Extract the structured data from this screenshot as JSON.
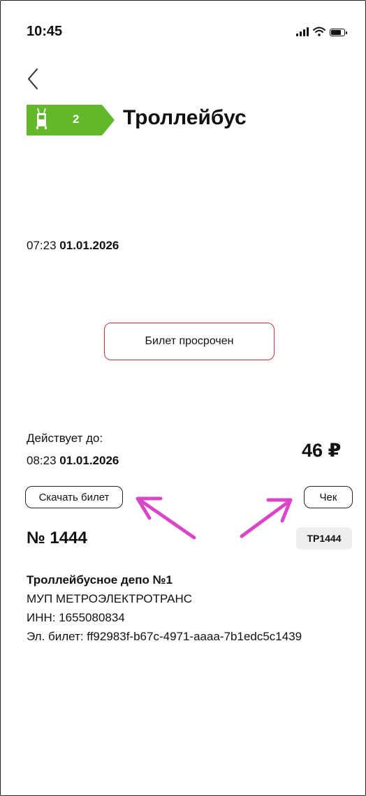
{
  "status_bar": {
    "time": "10:45"
  },
  "header": {
    "route_number": "2",
    "title": "Троллейбус"
  },
  "purchase": {
    "time": "07:23",
    "date": "01.01.2026"
  },
  "status": {
    "label": "Билет просрочен",
    "border_color": "#c8373d"
  },
  "validity": {
    "label": "Действует до:",
    "time": "08:23",
    "date": "01.01.2026"
  },
  "price": {
    "amount": "46 ₽"
  },
  "actions": {
    "download_label": "Скачать билет",
    "receipt_label": "Чек"
  },
  "ticket": {
    "number": "№ 1444",
    "code": "ТР1444"
  },
  "carrier": {
    "depot": "Троллейбусное депо №1",
    "company": "МУП МЕТРОЭЛЕКТРОТРАНС",
    "inn": "ИНН: 1655080834",
    "eticket": "Эл. билет: ff92983f-b67c-4971-aaaa-7b1edc5c1439"
  },
  "colors": {
    "badge_green": "#62b72b",
    "annotation_arrow": "#d946c8"
  }
}
